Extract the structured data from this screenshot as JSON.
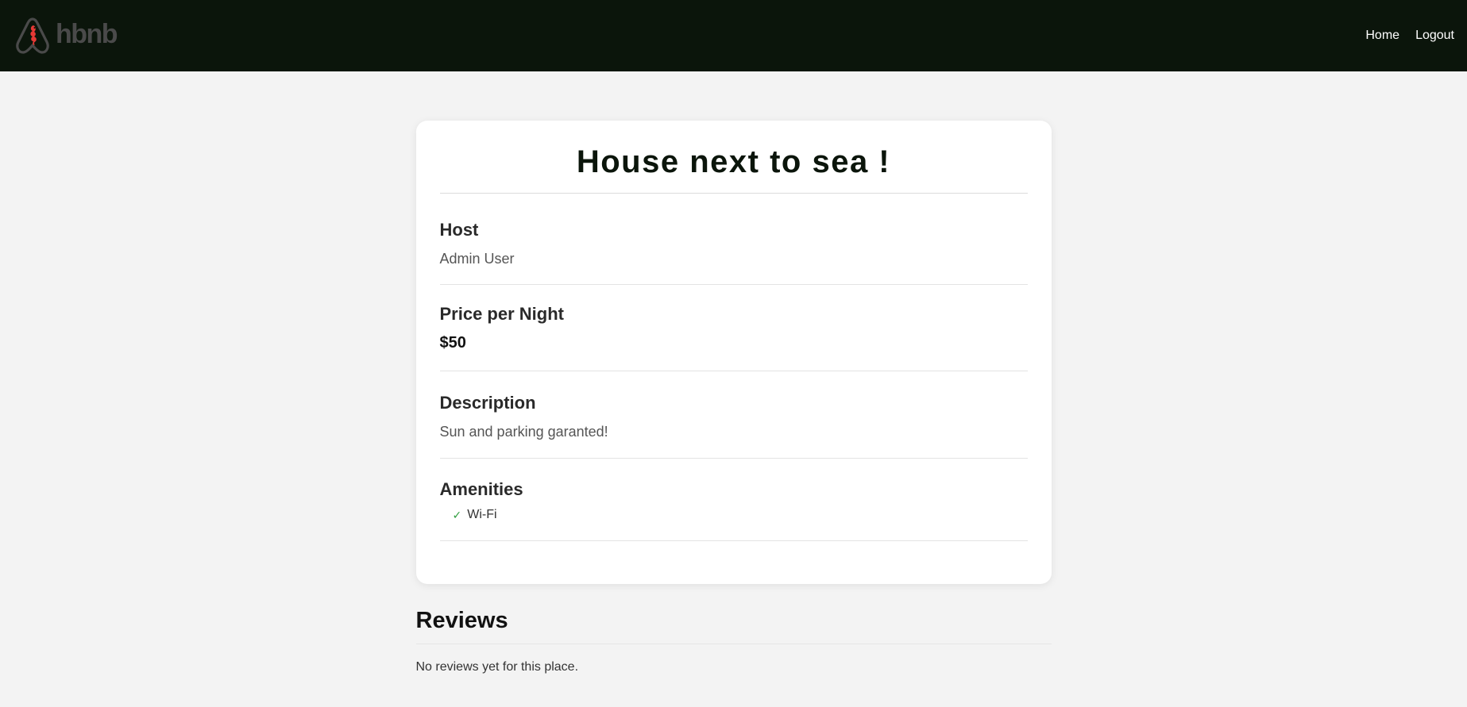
{
  "brand": {
    "logo_text": "hbnb",
    "logo_icon": "airbnb-seahorse-logo-icon",
    "accent": "#e53935"
  },
  "nav": {
    "home": "Home",
    "logout": "Logout"
  },
  "place": {
    "title": "House next to sea !",
    "host_heading": "Host",
    "host_name": "Admin User",
    "price_heading": "Price per Night",
    "price": "$50",
    "description_heading": "Description",
    "description": "Sun and parking garanted!",
    "amenities_heading": "Amenities",
    "amenities": [
      {
        "icon": "check-icon",
        "mark": "✓",
        "label": "Wi-Fi"
      }
    ]
  },
  "reviews": {
    "heading": "Reviews",
    "empty_message": "No reviews yet for this place."
  },
  "colors": {
    "header_bg": "#0b150b",
    "page_bg": "#f3f3f3",
    "check_green": "#2e9e3e"
  }
}
